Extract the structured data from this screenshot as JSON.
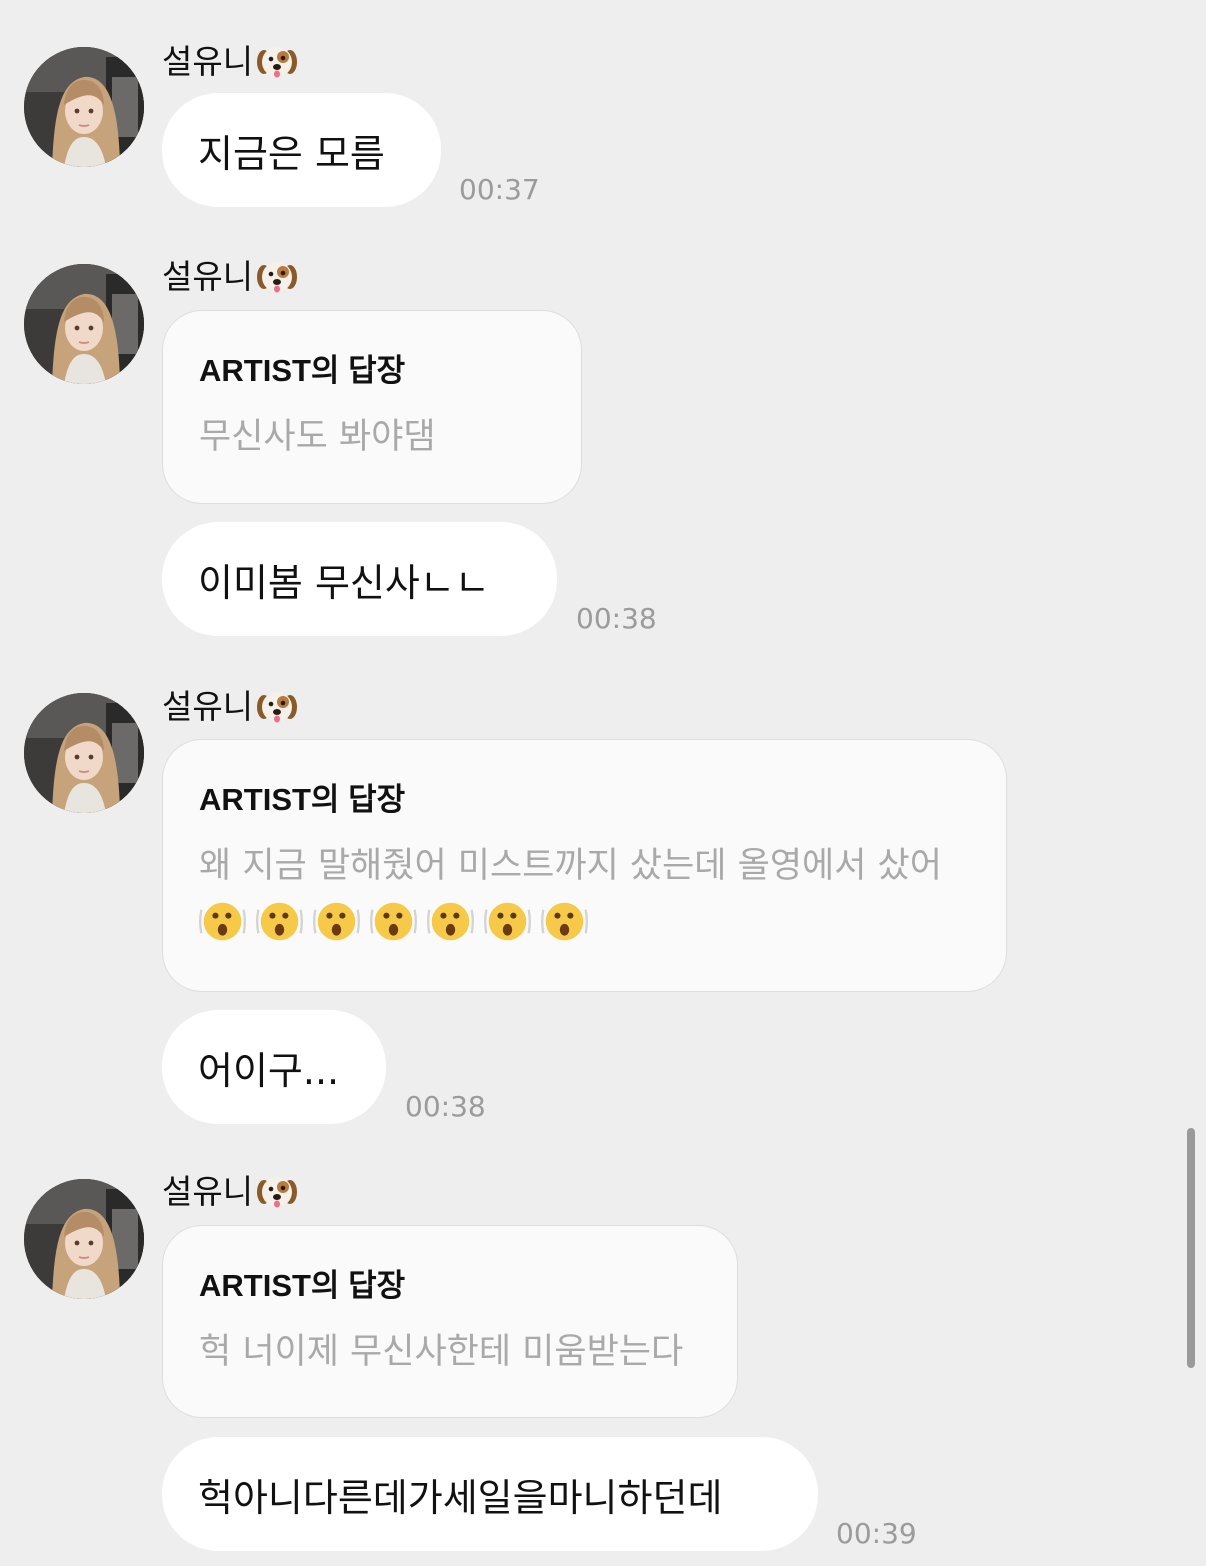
{
  "chat": {
    "sender_name": "설유니",
    "sender_emoji_icon": "dog-face-icon",
    "reply_title": "ARTIST의 답장",
    "groups": [
      {
        "messages": [
          {
            "kind": "text",
            "text": "지금은 모름",
            "time": "00:37"
          }
        ]
      },
      {
        "messages": [
          {
            "kind": "reply",
            "text": "무신사도 봐야댐"
          },
          {
            "kind": "text",
            "text": "이미봄 무신사ㄴㄴ",
            "time": "00:38"
          }
        ]
      },
      {
        "messages": [
          {
            "kind": "reply",
            "text": "왜 지금 말해줬어 미스트까지 샀는데 올영에서 샀어",
            "emoji_icon": "shaking-face-icon",
            "emoji_count": 7
          },
          {
            "kind": "text",
            "text": "어이구...",
            "time": "00:38"
          }
        ]
      },
      {
        "messages": [
          {
            "kind": "reply",
            "text": "헉 너이제 무신사한테 미움받는다"
          },
          {
            "kind": "text",
            "text": "헉아니다른데가세일을마니하던데",
            "time": "00:39"
          }
        ]
      }
    ]
  },
  "colors": {
    "background": "#eeeeee",
    "bubble": "#ffffff",
    "reply_bubble": "#fafafa",
    "reply_text": "#a9a9a9",
    "timestamp": "#9b9b9b"
  }
}
